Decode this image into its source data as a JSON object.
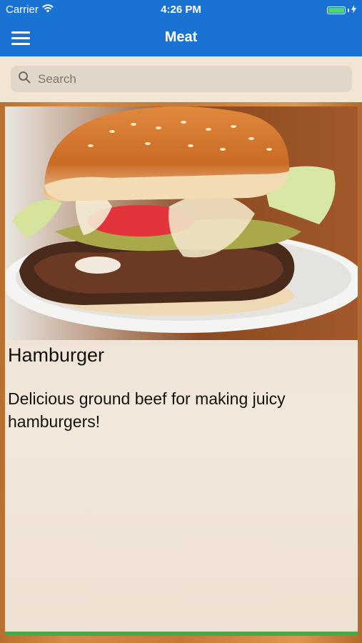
{
  "status_bar": {
    "carrier": "Carrier",
    "time": "4:26 PM",
    "battery_level": 1.0
  },
  "nav": {
    "title": "Meat",
    "menu_icon": "hamburger-menu-icon"
  },
  "search": {
    "placeholder": "Search",
    "value": "",
    "icon": "search-icon"
  },
  "item": {
    "title": "Hamburger",
    "description": "Delicious ground beef for making juicy hamburgers!",
    "image": "hamburger-photo"
  },
  "colors": {
    "nav_background": "#1a72d2",
    "card_background": "#f2e6da",
    "accent_bar": "#4ca847",
    "battery": "#4cd964"
  }
}
